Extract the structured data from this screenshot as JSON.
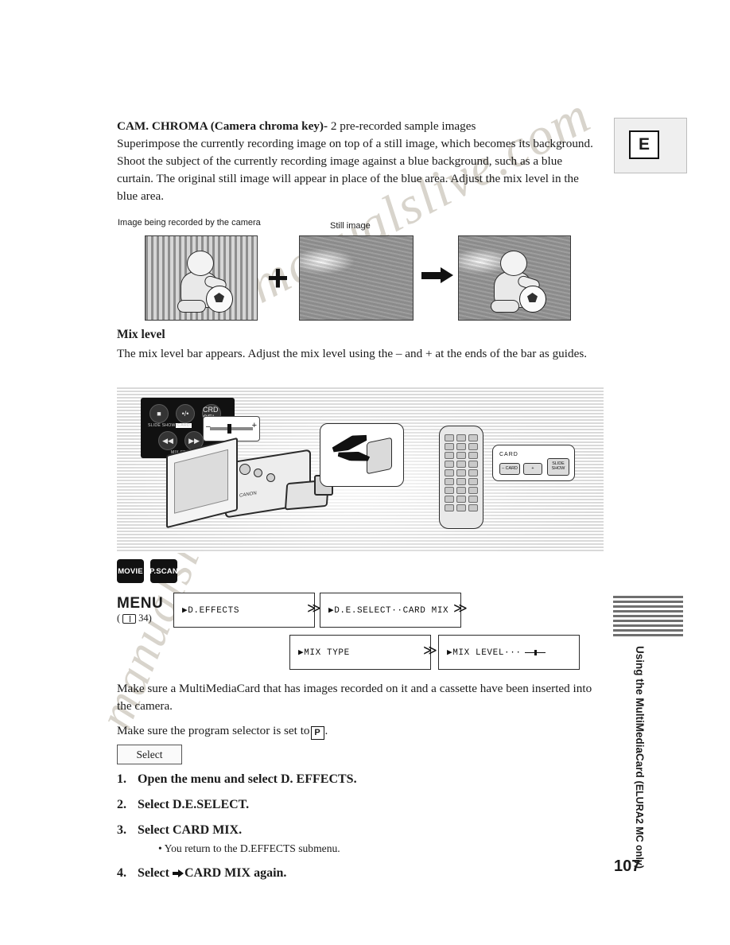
{
  "watermark": {
    "line1": "manualslive.com",
    "line2": "manualslive.com"
  },
  "header_box": {
    "letter": "E"
  },
  "intro": {
    "title": "CAM. CHROMA (Camera chroma key)-",
    "title_suffix": " 2 pre-recorded sample images",
    "body": "Superimpose the currently recording image on top of a still image, which becomes its background. Shoot the subject of the currently recording image against a blue background, such as a blue curtain. The original still image will appear in place of the blue area. Adjust the mix level in the blue area."
  },
  "figure_captions": {
    "left": "Image being recorded by the camera",
    "middle": "Still image",
    "plus": "+"
  },
  "mix_level": {
    "heading": "Mix level",
    "body": "The mix level bar appears. Adjust the mix level using the – and + at the ends of the bar as guides."
  },
  "illustration": {
    "remote_panel_buttons": [
      "■",
      "•/•",
      "CRD SEL"
    ],
    "remote_panel_buttons2": [
      "◀◀",
      "▶▶"
    ],
    "remote_panel_labels": [
      "SLIDE SHOW",
      "CARD",
      "-/EFFECTS"
    ],
    "remote_panel_label_bottom": "MIX SEARCH",
    "camera_label": "CANON",
    "remote_callout_title": "CARD",
    "remote_callout_keys": [
      "– CARD +",
      "SLIDE SHOW"
    ],
    "remote_key_minus": "– CARD",
    "remote_key_plus": "+",
    "remote_key_slide": "SLIDE SHOW"
  },
  "badges": [
    {
      "label": "MOVIE"
    },
    {
      "label": "P.SCAN"
    }
  ],
  "menu_flow": {
    "menu_word": "MENU",
    "menu_ref": "( ",
    "menu_ref_page": "34)",
    "boxes": [
      {
        "text": "▶D.EFFECTS"
      },
      {
        "text": "▶D.E.SELECT··CARD MIX"
      },
      {
        "text": "▶MIX TYPE"
      },
      {
        "text": "▶MIX LEVEL···"
      }
    ],
    "chevron": "≫"
  },
  "paragraphs": {
    "p1": "Make sure a MultiMediaCard that has images recorded on it and a cassette have been inserted into the camera.",
    "p2_before": "Make sure the program selector is set to ",
    "p2_badge": "P",
    "p2_after": "."
  },
  "select_button": {
    "label": "Select"
  },
  "steps": [
    {
      "num": "1.",
      "text": "Open the menu and select D. EFFECTS.",
      "sub": null
    },
    {
      "num": "2.",
      "text": "Select D.E.SELECT.",
      "sub": null
    },
    {
      "num": "3.",
      "text": "Select CARD MIX.",
      "sub": "• You return to the D.EFFECTS submenu."
    },
    {
      "num": "4.",
      "text": "CARD MIX again.",
      "prefix": "Select ",
      "sub": null
    }
  ],
  "side_tab": {
    "line1": "Using the MultiMediaCard",
    "line2": "(ELURA2 MC only)"
  },
  "page_number": "107"
}
